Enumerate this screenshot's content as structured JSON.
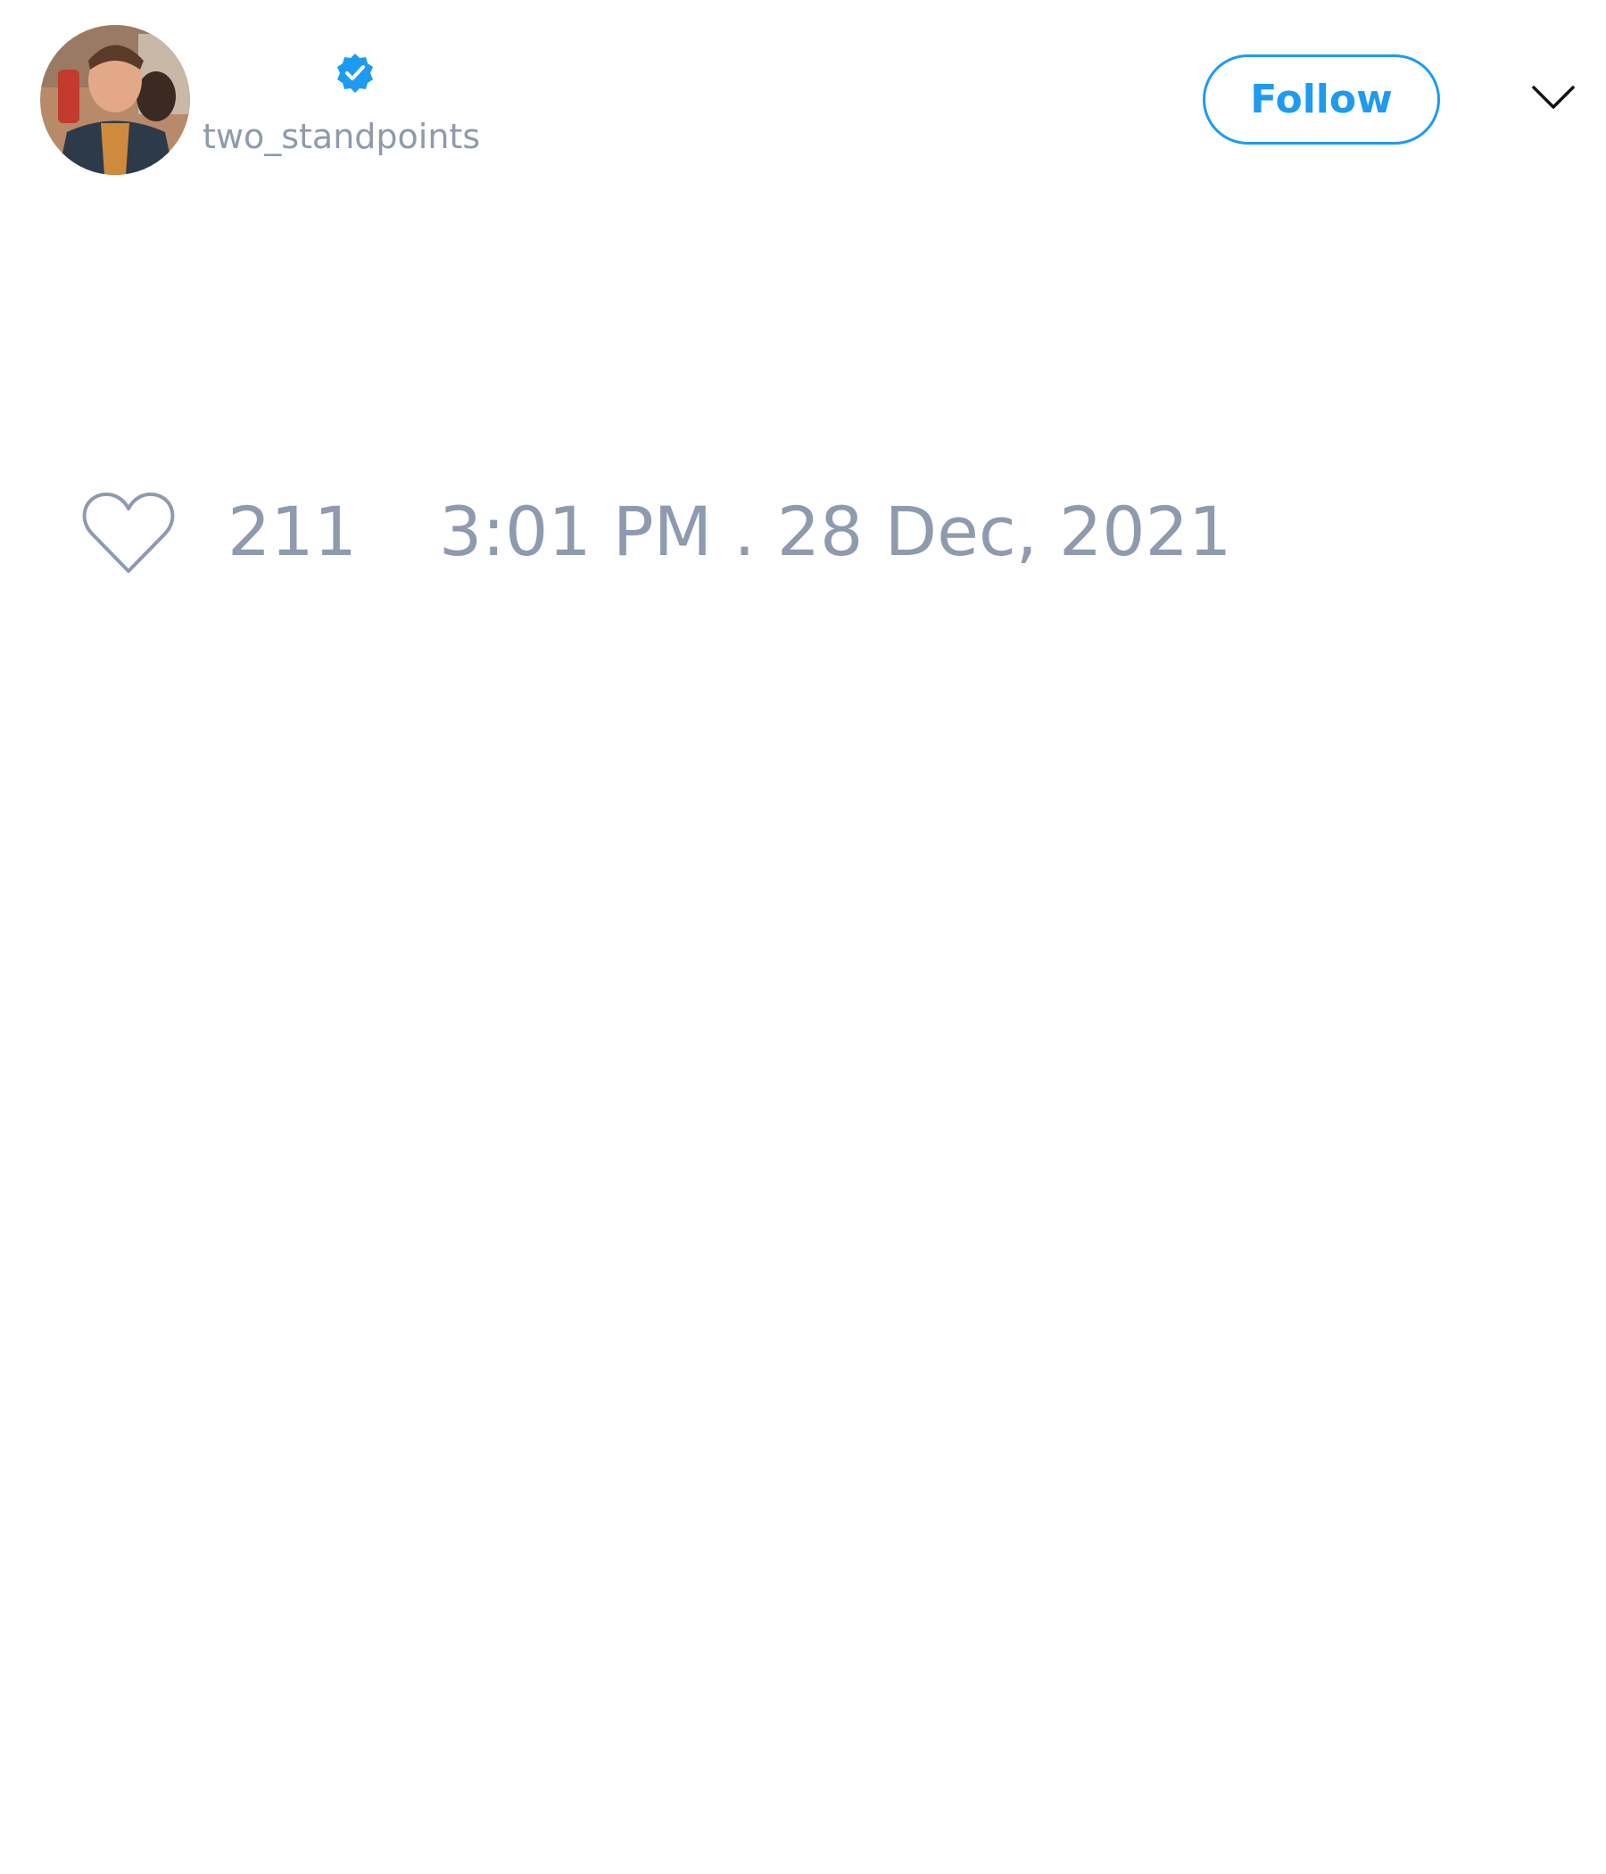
{
  "author": {
    "handle": "two_standpoints",
    "verified": true,
    "avatar_icon": "profile-photo",
    "verified_icon": "verified-badge-icon"
  },
  "header": {
    "follow_label": "Follow",
    "menu_icon": "chevron-down-icon"
  },
  "footer": {
    "like_icon": "heart-outline-icon",
    "like_count": "211",
    "timestamp": "3:01 PM . 28 Dec, 2021"
  },
  "colors": {
    "accent": "#1d9bf0",
    "muted_text": "#8e9aae",
    "background": "#ffffff"
  }
}
